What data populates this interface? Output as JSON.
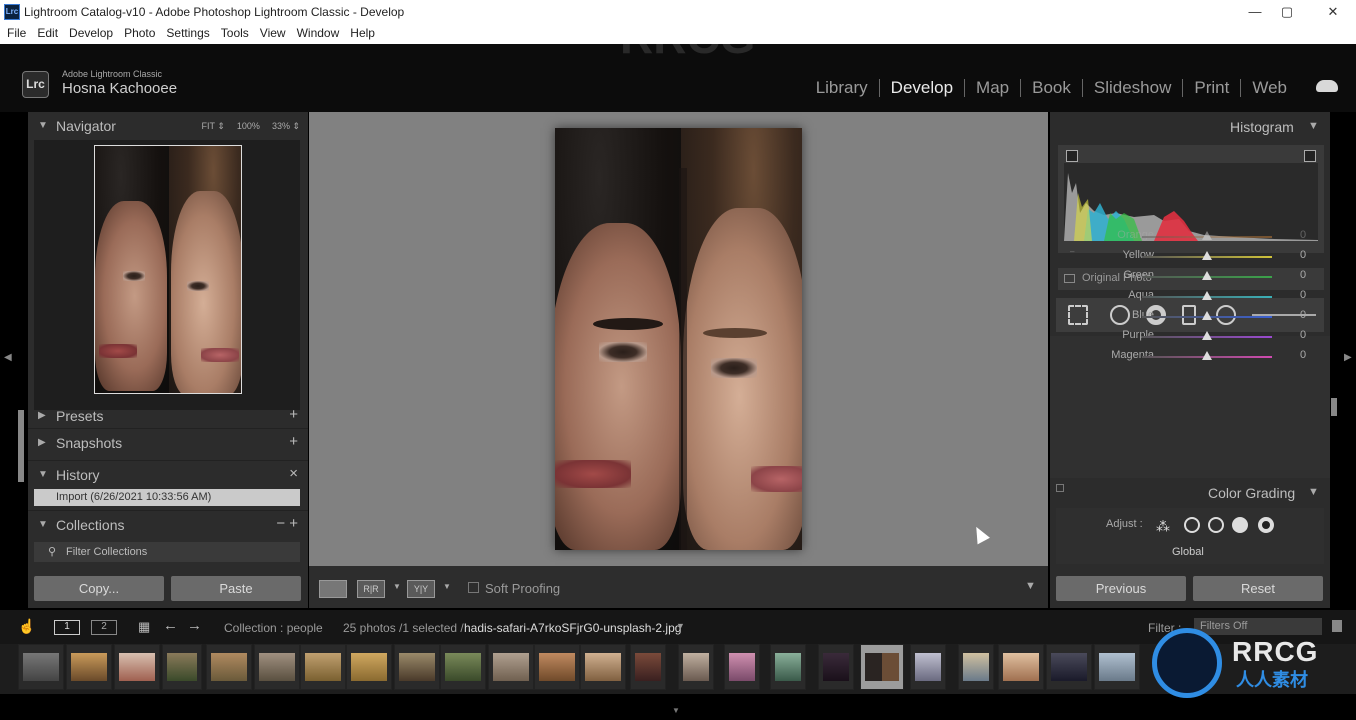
{
  "window": {
    "title": "Lightroom Catalog-v10 - Adobe Photoshop Lightroom Classic - Develop",
    "app_icon": "Lrc"
  },
  "menu": [
    "File",
    "Edit",
    "Develop",
    "Photo",
    "Settings",
    "Tools",
    "View",
    "Window",
    "Help"
  ],
  "identity": {
    "badge": "Lrc",
    "app": "Adobe Lightroom Classic",
    "user": "Hosna Kachooee"
  },
  "modules": [
    {
      "label": "Library",
      "active": false
    },
    {
      "label": "Develop",
      "active": true
    },
    {
      "label": "Map",
      "active": false
    },
    {
      "label": "Book",
      "active": false
    },
    {
      "label": "Slideshow",
      "active": false
    },
    {
      "label": "Print",
      "active": false
    },
    {
      "label": "Web",
      "active": false
    }
  ],
  "left_panel": {
    "navigator": {
      "title": "Navigator",
      "options": [
        "FIT ⇕",
        "100%",
        "33% ⇕"
      ]
    },
    "presets": {
      "title": "Presets",
      "action": "+"
    },
    "snapshots": {
      "title": "Snapshots",
      "action": "+"
    },
    "history": {
      "title": "History",
      "action": "×",
      "items": [
        "Import (6/26/2021 10:33:56 AM)"
      ]
    },
    "collections": {
      "title": "Collections",
      "actions": "− +",
      "filter": "Filter Collections"
    },
    "copy_label": "Copy...",
    "paste_label": "Paste"
  },
  "toolbar": {
    "soft_proofing": "Soft Proofing",
    "compare_a": "R|R",
    "compare_b": "Y|Y"
  },
  "right_panel": {
    "histogram": {
      "title": "Histogram",
      "original_photo": "Original Photo"
    },
    "hsl": [
      {
        "name": "Orange",
        "value": "0",
        "color": "#d7883a"
      },
      {
        "name": "Yellow",
        "value": "0",
        "color": "#cfc23a"
      },
      {
        "name": "Green",
        "value": "0",
        "color": "#3aa34a"
      },
      {
        "name": "Aqua",
        "value": "0",
        "color": "#3ab0b7"
      },
      {
        "name": "Blue",
        "value": "0",
        "color": "#3a5fd0"
      },
      {
        "name": "Purple",
        "value": "0",
        "color": "#9a4ad0"
      },
      {
        "name": "Magenta",
        "value": "0",
        "color": "#d04ab0"
      }
    ],
    "color_grading": {
      "title": "Color Grading",
      "adjust": "Adjust :",
      "global": "Global"
    },
    "previous_label": "Previous",
    "reset_label": "Reset"
  },
  "filmbar": {
    "page_1": "1",
    "page_2": "2",
    "collection": "Collection : people",
    "count": "25 photos /1 selected /",
    "filename": "hadis-safari-A7rkoSFjrG0-unsplash-2.jpg",
    "filter_label": "Filter :",
    "filter_value": "Filters Off"
  },
  "watermark": {
    "logo": "RRCG",
    "sub": "人人素材"
  },
  "colors": {
    "panel": "#2c2c2c",
    "center": "#818181",
    "accent": "#2f8de4"
  }
}
